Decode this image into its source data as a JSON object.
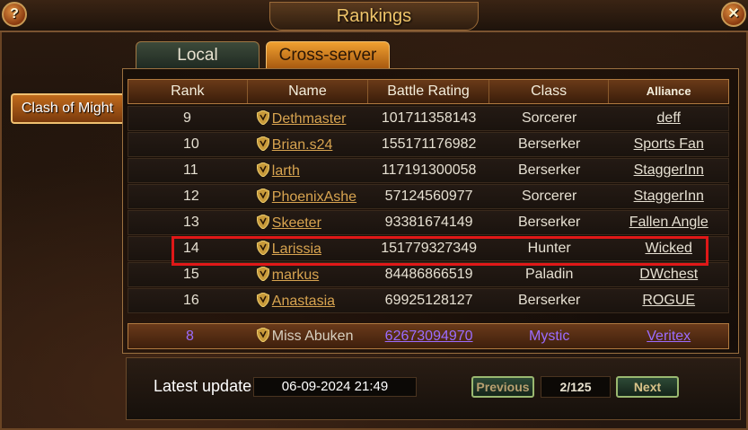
{
  "window": {
    "title": "Rankings",
    "help_label": "?",
    "close_label": "✕"
  },
  "tabs": [
    {
      "label": "Local",
      "active": false
    },
    {
      "label": "Cross-server",
      "active": true
    }
  ],
  "side_tab": {
    "label": "Clash of Might"
  },
  "table": {
    "headers": [
      "Rank",
      "Name",
      "Battle Rating",
      "Class",
      "Alliance"
    ],
    "rows": [
      {
        "rank": "9",
        "name": "Dethmaster",
        "battle_rating": "101711358143",
        "class": "Sorcerer",
        "alliance": "deff"
      },
      {
        "rank": "10",
        "name": "Brian.s24",
        "battle_rating": "155171176982",
        "class": "Berserker",
        "alliance": "Sports Fan"
      },
      {
        "rank": "11",
        "name": "larth",
        "battle_rating": "117191300058",
        "class": "Berserker",
        "alliance": "StaggerInn"
      },
      {
        "rank": "12",
        "name": "PhoenixAshe",
        "battle_rating": "57124560977",
        "class": "Sorcerer",
        "alliance": "StaggerInn"
      },
      {
        "rank": "13",
        "name": "Skeeter",
        "battle_rating": "93381674149",
        "class": "Berserker",
        "alliance": "Fallen Angle"
      },
      {
        "rank": "14",
        "name": "Larissia",
        "battle_rating": "151779327349",
        "class": "Hunter",
        "alliance": "Wicked"
      },
      {
        "rank": "15",
        "name": "markus",
        "battle_rating": "84486866519",
        "class": "Paladin",
        "alliance": "DWchest"
      },
      {
        "rank": "16",
        "name": "Anastasia",
        "battle_rating": "69925128127",
        "class": "Berserker",
        "alliance": "ROGUE"
      }
    ],
    "highlighted_rank": "14",
    "self_row": {
      "rank": "8",
      "name": "Miss Abuken",
      "battle_rating": "62673094970",
      "class": "Mystic",
      "alliance": "Veritex"
    }
  },
  "footer": {
    "latest_update_label": "Latest update",
    "latest_update_value": "06-09-2024 21:49",
    "previous_label": "Previous",
    "page_indicator": "2/125",
    "next_label": "Next"
  },
  "colors": {
    "accent_gold": "#f0c56a",
    "highlight_red": "#e01818",
    "self_purple": "#9b6cff"
  },
  "icons": {
    "row_name_icon": "shield-icon"
  }
}
